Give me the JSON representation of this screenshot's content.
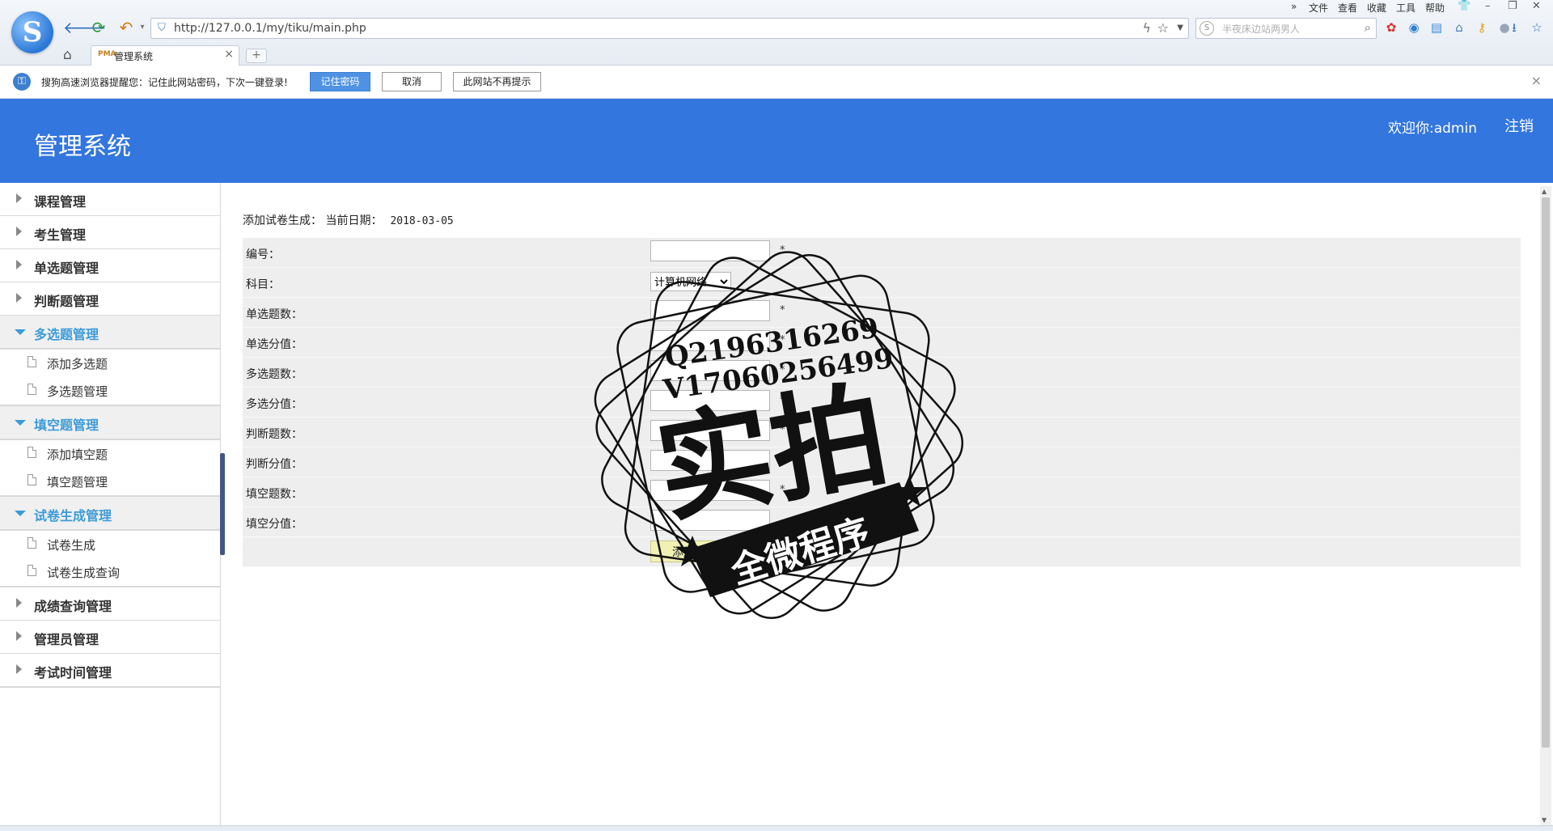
{
  "browser": {
    "url": "http://127.0.0.1/my/tiku/main.php",
    "search_placeholder": "半夜床边站两男人",
    "tab_title": "管理系统",
    "tab_favicon": "PMA",
    "new_tab": "+",
    "menu": [
      "文件",
      "查看",
      "收藏",
      "工具",
      "帮助"
    ],
    "more": "»"
  },
  "password_bar": {
    "message": "搜狗高速浏览器提醒您：记住此网站密码，下次一键登录!",
    "remember": "记住密码",
    "cancel": "取消",
    "never": "此网站不再提示",
    "close": "×"
  },
  "header": {
    "title": "管理系统",
    "welcome": "欢迎你:admin",
    "logout": "注销",
    "accent": "#3276de"
  },
  "sidebar": {
    "groups": [
      {
        "label": "课程管理",
        "open": false
      },
      {
        "label": "考生管理",
        "open": false
      },
      {
        "label": "单选题管理",
        "open": false
      },
      {
        "label": "判断题管理",
        "open": false
      },
      {
        "label": "多选题管理",
        "open": true,
        "items": [
          "添加多选题",
          "多选题管理"
        ]
      },
      {
        "label": "填空题管理",
        "open": true,
        "items": [
          "添加填空题",
          "填空题管理"
        ]
      },
      {
        "label": "试卷生成管理",
        "open": true,
        "items": [
          "试卷生成",
          "试卷生成查询"
        ]
      },
      {
        "label": "成绩查询管理",
        "open": false
      },
      {
        "label": "管理员管理",
        "open": false
      },
      {
        "label": "考试时间管理",
        "open": false
      }
    ]
  },
  "form": {
    "title": "添加试卷生成：  当前日期：",
    "date": "2018-03-05",
    "required_mark": "*",
    "fields": {
      "id": "编号：",
      "subject": "科目：",
      "single_count": "单选题数：",
      "single_score": "单选分值：",
      "multi_count": "多选题数：",
      "multi_score": "多选分值：",
      "judge_count": "判断题数：",
      "judge_score": "判断分值：",
      "blank_count": "填空题数：",
      "blank_score": "填空分值："
    },
    "subject_selected": "计算机网络",
    "submit": "添加"
  },
  "watermark": {
    "qq": "Q2196316269",
    "vx": "V17060256499",
    "big": "实拍",
    "ribbon": "全微程序"
  }
}
